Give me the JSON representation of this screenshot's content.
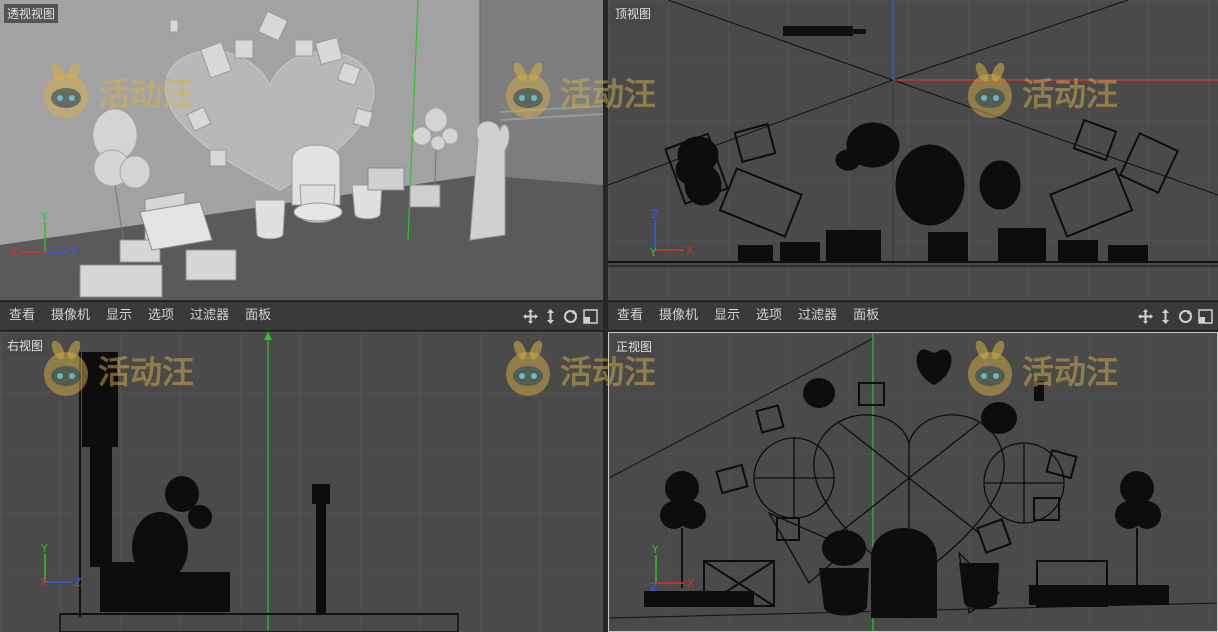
{
  "viewports": {
    "perspective": {
      "label": "透视视图"
    },
    "top": {
      "label": "顶视图"
    },
    "right": {
      "label": "右视图"
    },
    "front": {
      "label": "正视图"
    }
  },
  "menus": {
    "left": [
      "查看",
      "摄像机",
      "显示",
      "选项",
      "过滤器",
      "面板"
    ],
    "right": [
      "查看",
      "摄像机",
      "显示",
      "选项",
      "过滤器",
      "面板"
    ]
  },
  "nav_icons": [
    "move-icon",
    "zoom-icon",
    "rotate-icon",
    "maximize-icon"
  ],
  "axes": {
    "x": "X",
    "y": "Y",
    "z": "Z"
  },
  "watermark": "活动汪",
  "colors": {
    "x_axis": "#e03030",
    "y_axis": "#30c030",
    "z_axis": "#3060e0",
    "viewport_bg": "#4a4a4a",
    "menu_bg": "#3a3a3a",
    "active_border": "#c8c8c8"
  }
}
